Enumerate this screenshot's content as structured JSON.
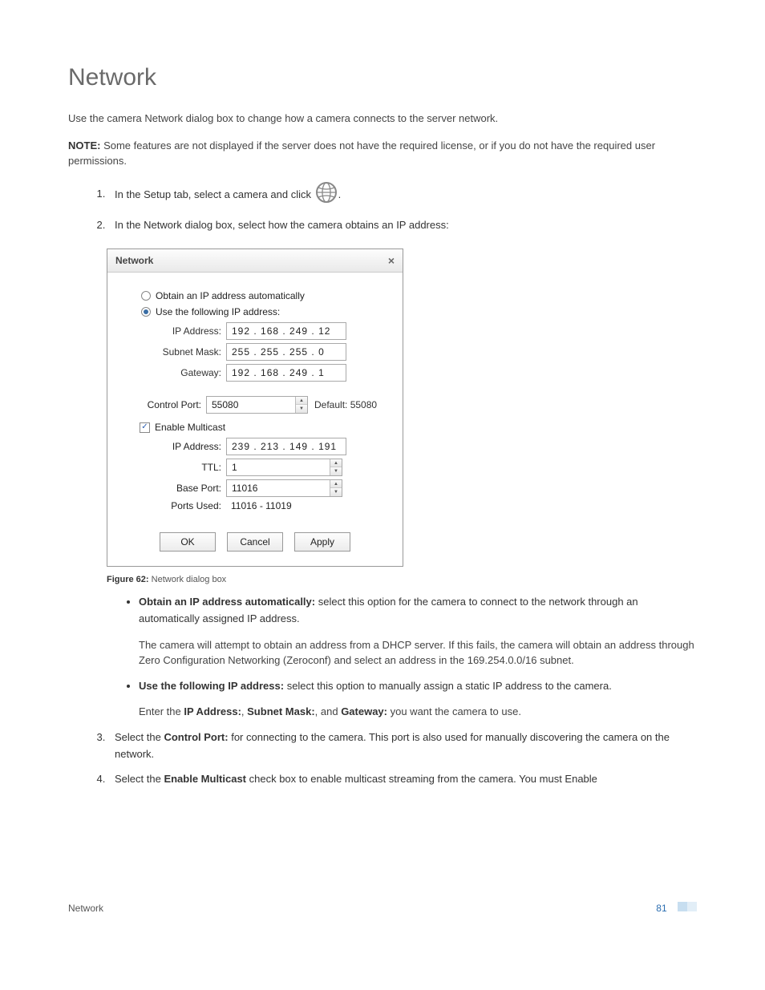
{
  "heading": "Network",
  "intro": "Use the camera Network dialog box to change how a camera connects to the server network.",
  "note_label": "NOTE:",
  "note_text": " Some features are not displayed if the server does not have the required license, or if you do not have the required user permissions.",
  "steps": {
    "s1_pre": "In the Setup tab, select a camera and click ",
    "s1_post": ".",
    "s2": "In the Network dialog box, select how the camera obtains an IP address:"
  },
  "dialog": {
    "title": "Network",
    "radio_auto": "Obtain an IP address automatically",
    "radio_static": "Use the following IP address:",
    "ip_label": "IP Address:",
    "ip_value": "192 . 168 . 249 .  12",
    "subnet_label": "Subnet Mask:",
    "subnet_value": "255 . 255 . 255 .   0",
    "gateway_label": "Gateway:",
    "gateway_value": "192 . 168 . 249 .   1",
    "control_port_label": "Control Port:",
    "control_port_value": "55080",
    "default_label": "Default: 55080",
    "enable_multicast": "Enable Multicast",
    "mc_ip_label": "IP Address:",
    "mc_ip_value": "239 . 213 . 149 . 191",
    "ttl_label": "TTL:",
    "ttl_value": "1",
    "base_port_label": "Base Port:",
    "base_port_value": "11016",
    "ports_used_label": "Ports Used:",
    "ports_used_value": "11016 - 11019",
    "ok": "OK",
    "cancel": "Cancel",
    "apply": "Apply"
  },
  "fig_caption_label": "Figure 62:",
  "fig_caption_text": " Network dialog box",
  "bullets": {
    "b1_strong": "Obtain an IP address automatically:",
    "b1_text": " select this option for the camera to connect to the network through an automatically assigned IP address.",
    "b1_para": "The camera will attempt to obtain an address from a DHCP server. If this fails, the camera will obtain an address through Zero Configuration Networking (Zeroconf) and select an address in the 169.254.0.0/16 subnet.",
    "b2_strong": "Use the following IP address:",
    "b2_text": " select this option to manually assign a static IP address to the camera.",
    "b2_para_pre": "Enter the ",
    "b2_ip": "IP Address:",
    "b2_sep1": ", ",
    "b2_subnet": "Subnet Mask:",
    "b2_sep2": ", and ",
    "b2_gateway": "Gateway:",
    "b2_para_post": " you want the camera to use."
  },
  "step3_pre": "Select the ",
  "step3_strong": "Control Port:",
  "step3_post": " for connecting to the camera. This port is also used for manually discovering the camera on the network.",
  "step4_pre": "Select the ",
  "step4_strong": "Enable Multicast",
  "step4_post": " check box to enable multicast streaming from the camera. You must Enable",
  "footer_left": "Network",
  "footer_page": "81"
}
